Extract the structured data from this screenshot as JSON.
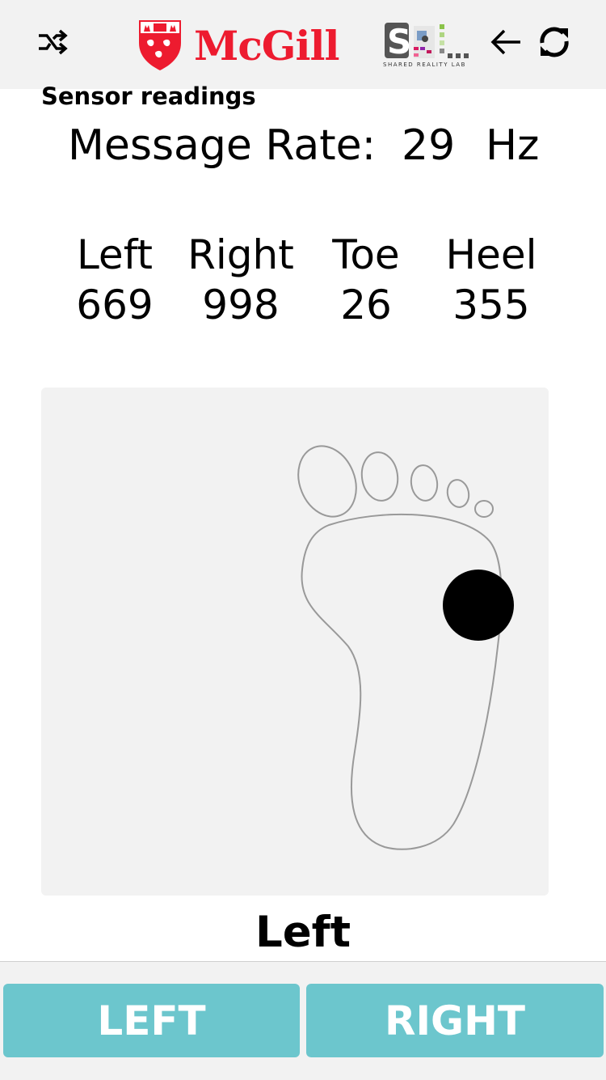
{
  "header": {
    "logo_text": "McGill",
    "lab_logo_letters": "SRL",
    "lab_logo_caption": "SHARED REALITY LAB",
    "icons": [
      "shuffle-icon",
      "back-arrow-icon",
      "refresh-icon"
    ]
  },
  "section_title": "Sensor readings",
  "message_rate": {
    "label": "Message Rate:",
    "value": "29",
    "unit": "Hz"
  },
  "readings": [
    {
      "label": "Left",
      "value": "669"
    },
    {
      "label": "Right",
      "value": "998"
    },
    {
      "label": "Toe",
      "value": "26"
    },
    {
      "label": "Heel",
      "value": "355"
    }
  ],
  "foot": {
    "selected_side": "Left",
    "pressure_indicator_color": "#000000"
  },
  "buttons": {
    "left": "LEFT",
    "right": "RIGHT"
  },
  "colors": {
    "brand_red": "#ed1b2f",
    "button": "#6cc6cd",
    "header_bg": "#f2f2f2"
  }
}
